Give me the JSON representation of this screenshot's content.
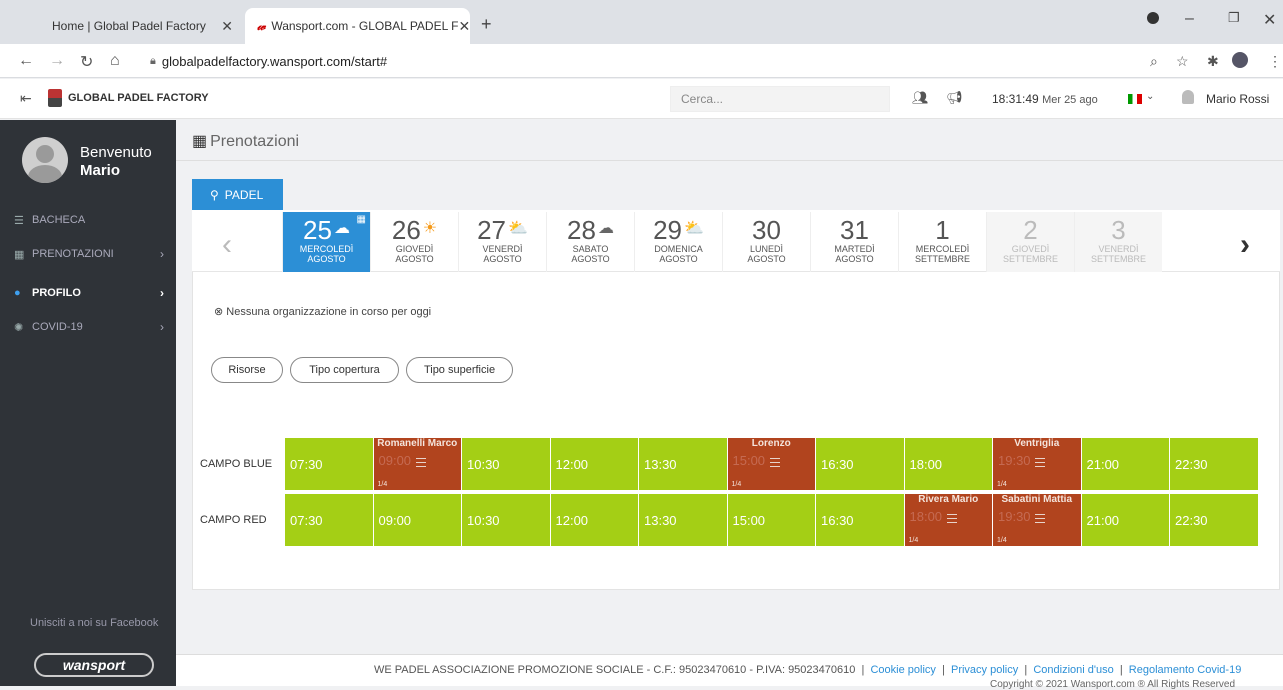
{
  "browser": {
    "tabs": [
      {
        "label": "Home | Global Padel Factory"
      },
      {
        "label": "Wansport.com - GLOBAL PADEL F"
      }
    ],
    "url": "globalpadelfactory.wansport.com/start#"
  },
  "header": {
    "brand": "GLOBAL PADEL FACTORY",
    "search_placeholder": "Cerca...",
    "time": "18:31:49",
    "date": "Mer 25 ago",
    "user": "Mario Rossi"
  },
  "sidebar": {
    "welcome": "Benvenuto",
    "name": "Mario",
    "items": [
      {
        "label": "BACHECA"
      },
      {
        "label": "PRENOTAZIONI"
      },
      {
        "label": "PROFILO"
      },
      {
        "label": "COVID-19"
      }
    ],
    "facebook": "Unisciti a noi su Facebook",
    "logo_text": "wansport"
  },
  "main": {
    "title": "Prenotazioni",
    "sport_tab": "PADEL",
    "dates": [
      {
        "num": "25",
        "day": "MERCOLEDÌ",
        "month": "AGOSTO",
        "weather": "rain"
      },
      {
        "num": "26",
        "day": "GIOVEDÌ",
        "month": "AGOSTO",
        "weather": "sun"
      },
      {
        "num": "27",
        "day": "VENERDÌ",
        "month": "AGOSTO",
        "weather": "sun-rain"
      },
      {
        "num": "28",
        "day": "SABATO",
        "month": "AGOSTO",
        "weather": "cloud"
      },
      {
        "num": "29",
        "day": "DOMENICA",
        "month": "AGOSTO",
        "weather": "sun-rain"
      },
      {
        "num": "30",
        "day": "LUNEDÌ",
        "month": "AGOSTO",
        "weather": ""
      },
      {
        "num": "31",
        "day": "MARTEDÌ",
        "month": "AGOSTO",
        "weather": ""
      },
      {
        "num": "1",
        "day": "MERCOLEDÌ",
        "month": "SETTEMBRE",
        "weather": ""
      },
      {
        "num": "2",
        "day": "GIOVEDÌ",
        "month": "SETTEMBRE",
        "weather": ""
      },
      {
        "num": "3",
        "day": "VENERDÌ",
        "month": "SETTEMBRE",
        "weather": ""
      }
    ],
    "notice": "Nessuna organizzazione in corso per oggi",
    "filters": [
      "Risorse",
      "Tipo copertura",
      "Tipo superficie"
    ],
    "courts": [
      {
        "name": "CAMPO BLUE",
        "slots": [
          {
            "time": "07:30"
          },
          {
            "time": "09:00",
            "booked_by": "Romanelli Marco",
            "fraction": "1/4"
          },
          {
            "time": "10:30"
          },
          {
            "time": "12:00"
          },
          {
            "time": "13:30"
          },
          {
            "time": "15:00",
            "booked_by": "Lorenzo",
            "fraction": "1/4"
          },
          {
            "time": "16:30"
          },
          {
            "time": "18:00"
          },
          {
            "time": "19:30",
            "booked_by": "Ventriglia",
            "fraction": "1/4"
          },
          {
            "time": "21:00"
          },
          {
            "time": "22:30"
          }
        ]
      },
      {
        "name": "CAMPO RED",
        "slots": [
          {
            "time": "07:30"
          },
          {
            "time": "09:00"
          },
          {
            "time": "10:30"
          },
          {
            "time": "12:00"
          },
          {
            "time": "13:30"
          },
          {
            "time": "15:00"
          },
          {
            "time": "16:30"
          },
          {
            "time": "18:00",
            "booked_by": "Rivera Mario",
            "fraction": "1/4"
          },
          {
            "time": "19:30",
            "booked_by": "Sabatini Mattia",
            "fraction": "1/4"
          },
          {
            "time": "21:00"
          },
          {
            "time": "22:30"
          }
        ]
      }
    ]
  },
  "footer": {
    "org": "WE PADEL ASSOCIAZIONE PROMOZIONE SOCIALE - C.F.: 95023470610 - P.IVA: 95023470610",
    "links": [
      "Cookie policy",
      "Privacy policy",
      "Condizioni d'uso",
      "Regolamento Covid-19"
    ],
    "copyright": "Copyright © 2021 Wansport.com ® All Rights Reserved"
  },
  "colors": {
    "accent": "#2c8fd6",
    "free_slot": "#a4cf15",
    "booked_slot": "#b1441e",
    "sidebar": "#2f3338"
  }
}
